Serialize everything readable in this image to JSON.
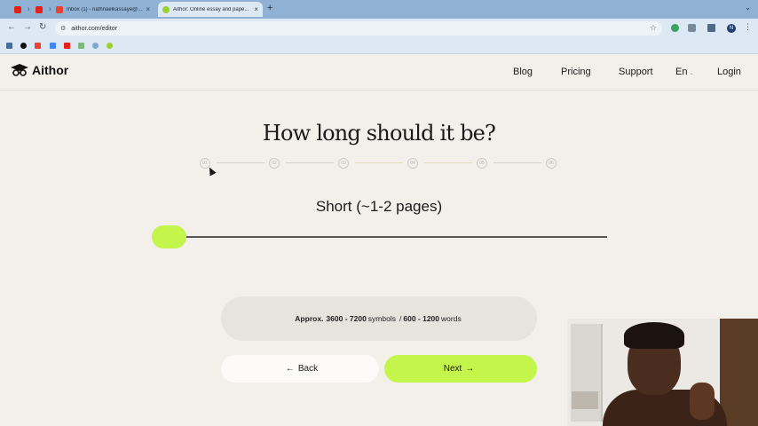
{
  "browser": {
    "tabs": [
      {
        "title": "",
        "favicon_color": "#e62117"
      },
      {
        "title": "",
        "favicon_color": "#e62117"
      },
      {
        "title": "Inbox (1) - nathnaelkassaye@...",
        "favicon_color": "#ea4335"
      },
      {
        "title": "Aithor: Online essay and pape...",
        "favicon_color": "#9bd12e",
        "active": true
      }
    ],
    "new_tab_label": "+",
    "url": "aithor.com/editor",
    "profile_initial": "N"
  },
  "site": {
    "brand": "Aithor",
    "nav": {
      "blog": "Blog",
      "pricing": "Pricing",
      "support": "Support",
      "language": "En",
      "login": "Login"
    }
  },
  "wizard": {
    "question": "How long should it be?",
    "steps": [
      "01",
      "02",
      "03",
      "04",
      "05",
      "06"
    ],
    "current_step": 1,
    "length_label": "Short (~1-2 pages)",
    "slider_position_fraction": 0,
    "approx": {
      "prefix": "Approx.",
      "symbols_range": "3600 - 7200",
      "symbols_word": "symbols",
      "separator": "/",
      "words_range": "600 - 1200",
      "words_word": "words"
    },
    "back_label": "Back",
    "next_label": "Next"
  },
  "colors": {
    "accent": "#c4f54a",
    "page_bg": "#f3f0ec",
    "tabstrip": "#8fb2d4"
  }
}
